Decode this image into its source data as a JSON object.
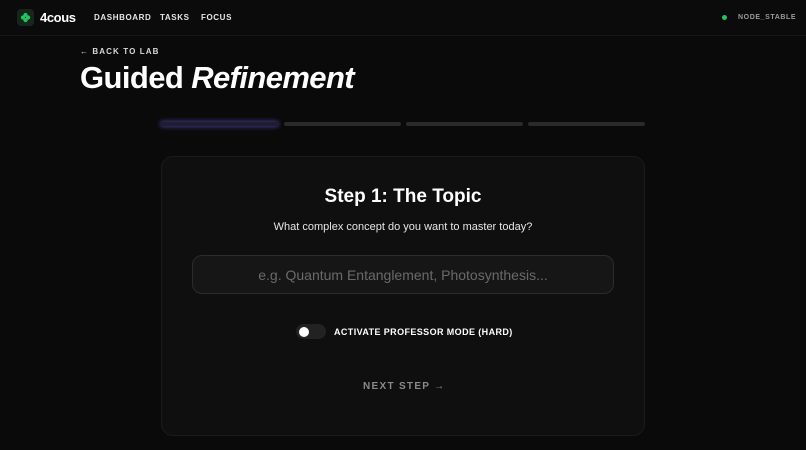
{
  "header": {
    "brand": "4cous",
    "nav": [
      "DASHBOARD",
      "TASKS",
      "FOCUS"
    ],
    "status": "NODE_STABLE",
    "status_color": "#22c55e",
    "logo_icon": "clover-icon",
    "logo_color": "#22c55e"
  },
  "page": {
    "back_label": "← BACK TO LAB",
    "title_regular": "Guided",
    "title_italic": "Refinement"
  },
  "progress": {
    "total_steps": 4,
    "current_step": 1,
    "accent": "#6e5fe6"
  },
  "step": {
    "title": "Step 1: The Topic",
    "subtitle": "What complex concept do you want to master today?",
    "input_value": "",
    "input_placeholder": "e.g. Quantum Entanglement, Photosynthesis...",
    "toggle_label": "ACTIVATE PROFESSOR MODE (HARD)",
    "toggle_on": false,
    "next_label": "NEXT STEP →"
  }
}
